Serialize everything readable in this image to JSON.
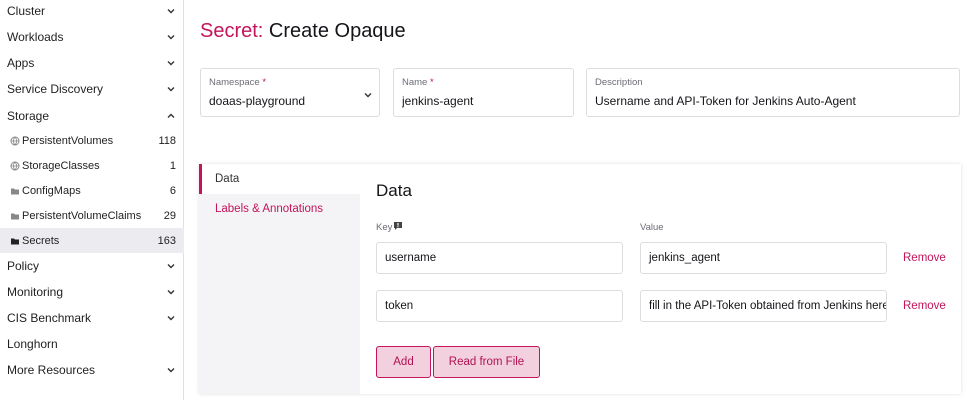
{
  "sidebar": {
    "groups_top": [
      {
        "label": "Cluster",
        "expanded": false
      },
      {
        "label": "Workloads",
        "expanded": false
      },
      {
        "label": "Apps",
        "expanded": false
      },
      {
        "label": "Service Discovery",
        "expanded": false
      },
      {
        "label": "Storage",
        "expanded": true
      }
    ],
    "storage_items": [
      {
        "label": "PersistentVolumes",
        "count": "118",
        "icon": "globe-icon"
      },
      {
        "label": "StorageClasses",
        "count": "1",
        "icon": "globe-icon"
      },
      {
        "label": "ConfigMaps",
        "count": "6",
        "icon": "folder-icon"
      },
      {
        "label": "PersistentVolumeClaims",
        "count": "29",
        "icon": "folder-icon"
      },
      {
        "label": "Secrets",
        "count": "163",
        "icon": "folder-icon",
        "active": true
      }
    ],
    "groups_bottom": [
      {
        "label": "Policy",
        "expanded": false
      },
      {
        "label": "Monitoring",
        "expanded": false
      },
      {
        "label": "CIS Benchmark",
        "expanded": false
      },
      {
        "label": "Longhorn",
        "expanded": null
      },
      {
        "label": "More Resources",
        "expanded": false
      }
    ]
  },
  "header": {
    "title_prefix": "Secret:",
    "title_rest": "Create Opaque"
  },
  "form": {
    "namespace": {
      "label": "Namespace",
      "required_mark": "*",
      "value": "doaas-playground"
    },
    "name": {
      "label": "Name",
      "required_mark": "*",
      "value": "jenkins-agent"
    },
    "description": {
      "label": "Description",
      "value": "Username and API-Token for Jenkins Auto-Agent"
    }
  },
  "tabs": [
    {
      "label": "Data",
      "active": true
    },
    {
      "label": "Labels & Annotations",
      "active": false
    }
  ],
  "data_section": {
    "title": "Data",
    "key_header": "Key",
    "value_header": "Value",
    "rows": [
      {
        "key": "username",
        "value": "jenkins_agent",
        "remove_label": "Remove"
      },
      {
        "key": "token",
        "value": "fill in the API-Token obtained from Jenkins here",
        "remove_label": "Remove"
      }
    ],
    "add_label": "Add",
    "read_file_label": "Read from File"
  },
  "colors": {
    "accent": "#c4145b",
    "button_bg": "#f3d0de",
    "active_nav_bg": "#ececf0"
  }
}
